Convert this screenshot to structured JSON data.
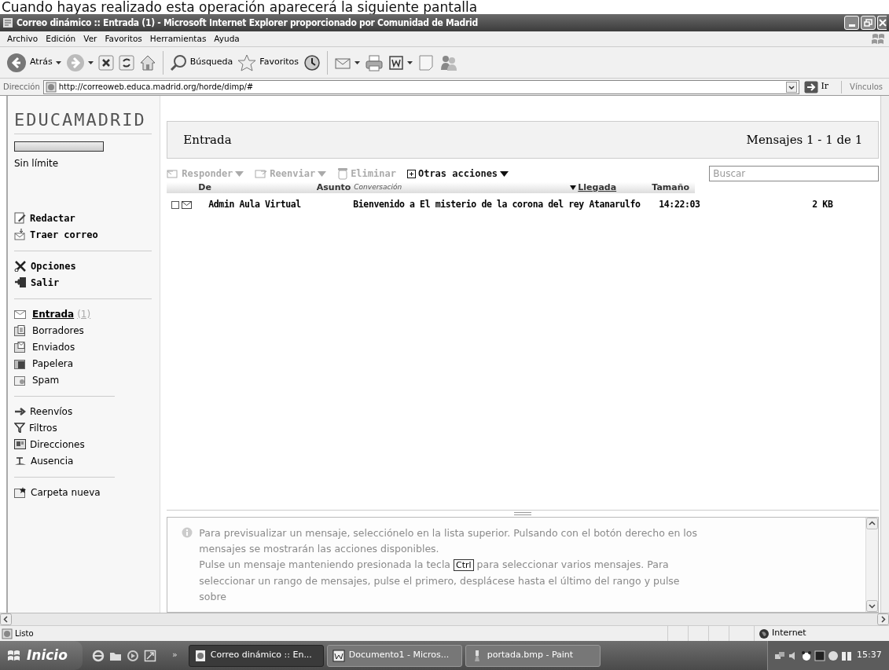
{
  "caption": "Cuando hayas realizado esta operación aparecerá la siguiente pantalla",
  "window": {
    "title": "Correo dinámico :: Entrada (1) - Microsoft Internet Explorer proporcionado por Comunidad de Madrid"
  },
  "menu": [
    "Archivo",
    "Edición",
    "Ver",
    "Favoritos",
    "Herramientas",
    "Ayuda"
  ],
  "toolbar": [
    {
      "kind": "back",
      "label": "Atrás",
      "dropdown": true
    },
    {
      "kind": "forward",
      "dropdown": true
    },
    {
      "kind": "stop",
      "dropdown": false
    },
    {
      "kind": "refresh",
      "dropdown": false
    },
    {
      "kind": "home",
      "dropdown": false
    },
    {
      "kind": "separator"
    },
    {
      "kind": "search",
      "label": "Búsqueda",
      "dropdown": false
    },
    {
      "kind": "favorites",
      "label": "Favoritos",
      "dropdown": false
    },
    {
      "kind": "history",
      "dropdown": false
    },
    {
      "kind": "separator"
    },
    {
      "kind": "mail",
      "dropdown": true
    },
    {
      "kind": "print",
      "dropdown": false
    },
    {
      "kind": "word",
      "dropdown": true
    },
    {
      "kind": "note",
      "dropdown": false
    },
    {
      "kind": "messenger",
      "dropdown": false
    }
  ],
  "address": {
    "label": "Dirección",
    "url": "http://correoweb.educa.madrid.org/horde/dimp/#",
    "go": "Ir",
    "links": "Vínculos"
  },
  "sidebar": {
    "logo": "EDUCAMADRID",
    "quota": {
      "label": "Sin límite"
    },
    "groups": [
      {
        "kind": "actions",
        "items": [
          {
            "label": "Redactar"
          },
          {
            "label": "Traer correo"
          }
        ]
      },
      {
        "kind": "actions",
        "items": [
          {
            "label": "Opciones"
          },
          {
            "label": "Salir"
          }
        ]
      },
      {
        "kind": "folders",
        "items": [
          {
            "label": "Entrada",
            "count": "(1)",
            "selected": true
          },
          {
            "label": "Borradores",
            "selected": false
          },
          {
            "label": "Enviados",
            "selected": false
          },
          {
            "label": "Papelera",
            "selected": false
          },
          {
            "label": "Spam",
            "selected": false
          }
        ]
      },
      {
        "kind": "tools",
        "items": [
          {
            "label": "Reenvíos"
          },
          {
            "label": "Filtros"
          },
          {
            "label": "Direcciones"
          },
          {
            "label": "Ausencia"
          }
        ]
      },
      {
        "kind": "tools",
        "items": [
          {
            "label": "Carpeta nueva"
          }
        ]
      }
    ]
  },
  "main": {
    "title": "Entrada",
    "range": "Mensajes 1 - 1 de 1",
    "actions": [
      {
        "label": "Responder",
        "dropdown": true,
        "disabled": true
      },
      {
        "label": "Reenviar",
        "dropdown": true,
        "disabled": true
      },
      {
        "label": "Eliminar",
        "dropdown": false,
        "disabled": true
      },
      {
        "label": "Otras acciones",
        "dropdown": true,
        "disabled": false
      }
    ],
    "search": {
      "placeholder": "Buscar"
    },
    "columns": [
      {
        "label": "De",
        "sorted": false
      },
      {
        "label": "Asunto",
        "note": "Conversación",
        "sorted": false
      },
      {
        "label": "Llegada",
        "sorted": true
      },
      {
        "label": "Tamaño",
        "sorted": false
      }
    ],
    "rows": [
      {
        "from": "Admin Aula Virtual",
        "subject": "Bienvenido a El misterio de la corona del rey Atanarulfo",
        "time": "14:22:03",
        "size": "2 KB",
        "checked": false
      }
    ]
  },
  "preview": {
    "paragraph": "Para previsualizar un mensaje, selecciónelo en la lista superior. Pulsando con el botón derecho en los mensajes se mostrarán las acciones disponibles.",
    "before": "Pulse un mensaje manteniendo presionada la tecla",
    "key": "Ctrl",
    "after": "para seleccionar varios mensajes. Para seleccionar un rango de mensajes, pulse el primero, desplácese hasta el último del rango y pulse sobre"
  },
  "status": {
    "text": "Listo",
    "zone": "Internet"
  },
  "taskbar": {
    "start": "Inicio",
    "more": "»",
    "tasks": [
      {
        "label": "Correo dinámico :: En...",
        "selected": true
      },
      {
        "label": "Documento1 - Micros...",
        "selected": false
      },
      {
        "label": "portada.bmp - Paint",
        "selected": false
      }
    ],
    "clock": "15:37"
  }
}
